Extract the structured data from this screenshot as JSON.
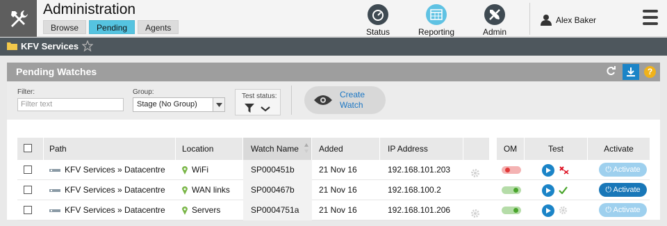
{
  "app": {
    "title": "Administration",
    "tabs": [
      {
        "label": "Browse",
        "active": false
      },
      {
        "label": "Pending",
        "active": true
      },
      {
        "label": "Agents",
        "active": false
      }
    ]
  },
  "topnav": {
    "status_label": "Status",
    "reporting_label": "Reporting",
    "admin_label": "Admin",
    "user_name": "Alex Baker"
  },
  "breadcrumb": {
    "label": "KFV Services"
  },
  "panel": {
    "title": "Pending Watches",
    "help_label": "?",
    "filter": {
      "label": "Filter:",
      "placeholder": "Filter text"
    },
    "group": {
      "label": "Group:",
      "value": "Stage (No Group)"
    },
    "test_status": {
      "label": "Test status:"
    },
    "create_label_1": "Create",
    "create_label_2": "Watch"
  },
  "table": {
    "headers": {
      "path": "Path",
      "location": "Location",
      "watch_name": "Watch Name",
      "added": "Added",
      "ip": "IP Address",
      "om": "OM",
      "test": "Test",
      "activate": "Activate"
    },
    "rows": [
      {
        "path": "KFV Services » Datacentre",
        "location": "WiFi",
        "watch_name": "SP000451b",
        "added": "21 Nov 16",
        "ip": "192.168.101.203",
        "om": "off",
        "test": "failed",
        "activate": "Activate",
        "activate_style": "light"
      },
      {
        "path": "KFV Services » Datacentre",
        "location": "WAN links",
        "watch_name": "SP000467b",
        "added": "21 Nov 16",
        "ip": "192.168.100.2",
        "om": "on",
        "test": "passed",
        "activate": "Activate",
        "activate_style": "dark"
      },
      {
        "path": "KFV Services » Datacentre",
        "location": "Servers",
        "watch_name": "SP0004751a",
        "added": "21 Nov 16",
        "ip": "192.168.101.206",
        "om": "on",
        "test": "pending",
        "activate": "Activate",
        "activate_style": "light"
      }
    ]
  },
  "colors": {
    "accent": "#55c3e0",
    "primary_blue": "#1b84c7",
    "help_orange": "#f0b21a",
    "breadcrumb_bar": "#4e575d",
    "panel_header": "#9e9e9e"
  }
}
